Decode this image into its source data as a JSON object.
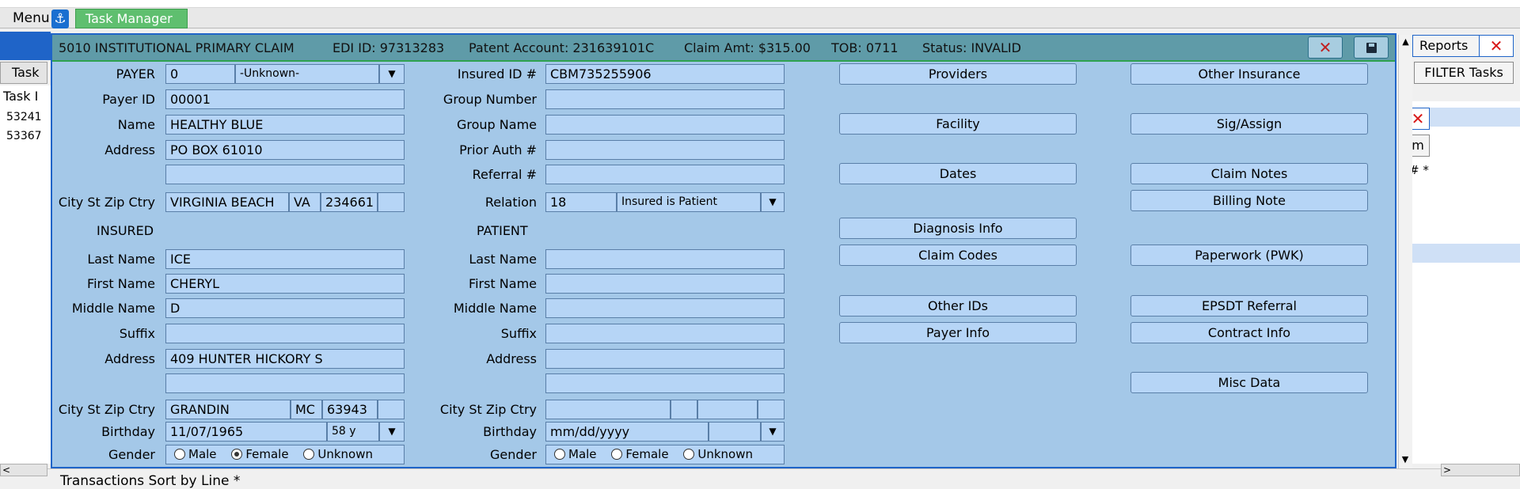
{
  "app": {
    "menu_label": "Menu",
    "task_manager_tab": "Task Manager"
  },
  "background": {
    "task_btn": "Task",
    "task_id_header": "Task I",
    "rows": [
      "53241",
      "53367"
    ],
    "reports_btn": "Reports",
    "reports_close": "✕",
    "filter_btn": "FILTER Tasks",
    "inner_close": "✕",
    "inner_btn": "rm",
    "inner_hash": "# *",
    "transactions_label": "Transactions Sort by Line *"
  },
  "dialog": {
    "title": {
      "claim_type": "5010 INSTITUTIONAL PRIMARY CLAIM",
      "edi_id": "EDI ID: 97313283",
      "patient_account": "Patent Account: 231639101C",
      "claim_amt": "Claim Amt: $315.00",
      "tob": "TOB: 0711",
      "status": "Status: INVALID"
    },
    "close_label": "✕",
    "payer": {
      "payer_label": "PAYER",
      "payer_code": "0",
      "payer_name_select": "-Unknown-",
      "payer_id_label": "Payer ID",
      "payer_id": "00001",
      "name_label": "Name",
      "name": "HEALTHY BLUE",
      "address_label": "Address",
      "address1": "PO BOX 61010",
      "address2": "",
      "city_label": "City St Zip Ctry",
      "city": "VIRGINIA BEACH",
      "state": "VA",
      "zip": "234661",
      "country": ""
    },
    "insured_header": "INSURED",
    "insured": {
      "last_name_label": "Last Name",
      "last_name": "ICE",
      "first_name_label": "First Name",
      "first_name": "CHERYL",
      "middle_name_label": "Middle Name",
      "middle_name": "D",
      "suffix_label": "Suffix",
      "suffix": "",
      "address_label": "Address",
      "address1": "409 HUNTER HICKORY S",
      "address2": "",
      "city_label": "City St Zip Ctry",
      "city": "GRANDIN",
      "state": "MC",
      "zip": "63943",
      "country": "",
      "birthday_label": "Birthday",
      "birthday": "11/07/1965",
      "age": "58 y",
      "gender_label": "Gender",
      "gender_options": [
        "Male",
        "Female",
        "Unknown"
      ],
      "gender_selected": "Female"
    },
    "middle": {
      "insured_id_label": "Insured ID #",
      "insured_id": "CBM735255906",
      "group_number_label": "Group Number",
      "group_number": "",
      "group_name_label": "Group Name",
      "group_name": "",
      "prior_auth_label": "Prior Auth #",
      "prior_auth": "",
      "referral_label": "Referral #",
      "referral": "",
      "relation_label": "Relation",
      "relation_code": "18",
      "relation_select": "Insured is Patient"
    },
    "patient_header": "PATIENT",
    "patient": {
      "last_name_label": "Last Name",
      "first_name_label": "First Name",
      "middle_name_label": "Middle Name",
      "suffix_label": "Suffix",
      "address_label": "Address",
      "city_label": "City St Zip Ctry",
      "birthday_label": "Birthday",
      "birthday_placeholder": "mm/dd/yyyy",
      "gender_label": "Gender",
      "gender_options": [
        "Male",
        "Female",
        "Unknown"
      ]
    },
    "buttons_col1": {
      "providers": "Providers",
      "facility": "Facility",
      "dates": "Dates",
      "diagnosis_info": "Diagnosis Info",
      "claim_codes": "Claim Codes",
      "other_ids": "Other IDs",
      "payer_info": "Payer Info"
    },
    "buttons_col2": {
      "other_insurance": "Other Insurance",
      "sig_assign": "Sig/Assign",
      "claim_notes": "Claim Notes",
      "billing_note": "Billing Note",
      "paperwork": "Paperwork (PWK)",
      "epsdt_referral": "EPSDT Referral",
      "contract_info": "Contract Info",
      "misc_data": "Misc Data"
    }
  }
}
